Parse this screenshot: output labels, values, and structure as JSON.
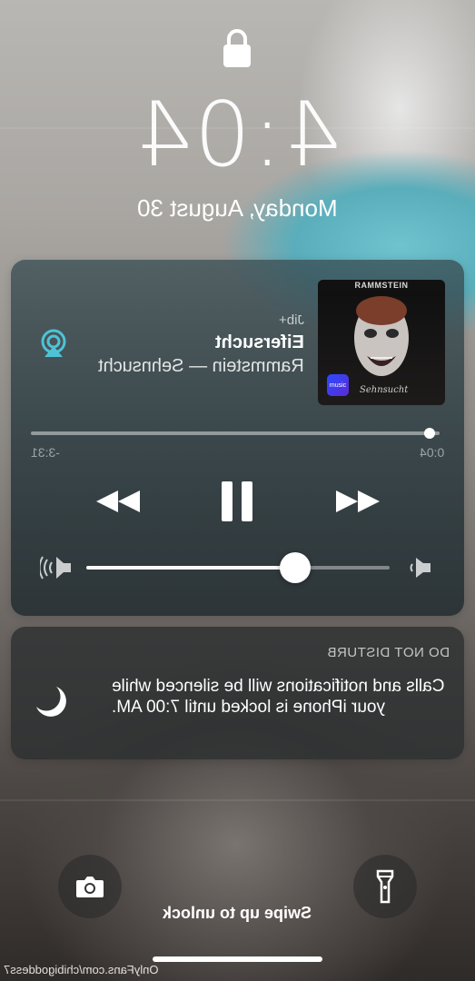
{
  "lockscreen": {
    "time": "4:04",
    "date": "Monday, August 30"
  },
  "media": {
    "source": "Jib+",
    "title": "Eifersucht",
    "subtitle": "Rammstein — Sehnsucht",
    "elapsed": "0:04",
    "remaining": "-3:31",
    "progress": 0.02,
    "volume": 0.69,
    "artwork": {
      "band_text": "RAMMSTEIN",
      "badge_text": "music",
      "signature_text": "Sehnsucht"
    }
  },
  "dnd": {
    "header": "DO NOT DISTURB",
    "body": "Calls and notifications will be silenced while your iPhone is locked until 7:00 AM."
  },
  "bottom": {
    "swipe_hint": "Swipe up to unlock",
    "watermark": "OnlyFans.com/chibigoddess7"
  },
  "icons": {
    "lock": "lock-icon",
    "airplay": "airplay-icon",
    "rewind": "rewind-icon",
    "pause": "pause-icon",
    "forward": "fast-forward-icon",
    "volume_low": "volume-low-icon",
    "volume_high": "volume-high-icon",
    "moon": "moon-icon",
    "camera": "camera-icon",
    "flashlight": "flashlight-icon"
  },
  "colors": {
    "airplay_accent": "#4fc3d6"
  }
}
